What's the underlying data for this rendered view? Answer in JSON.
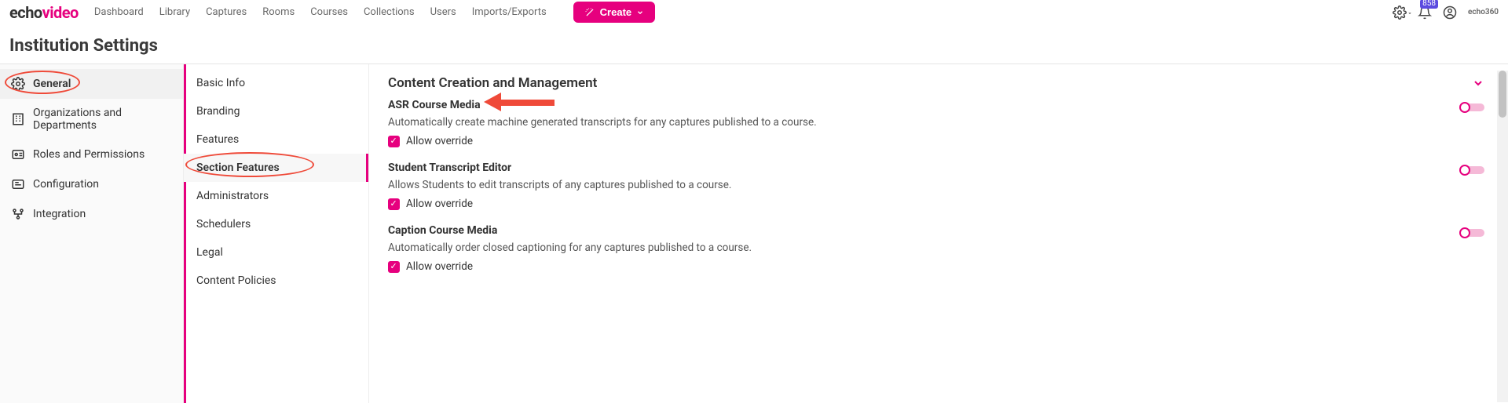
{
  "brand": {
    "part1": "echo",
    "part2": "video",
    "mini": "echo360"
  },
  "topnav": {
    "dashboard": "Dashboard",
    "library": "Library",
    "captures": "Captures",
    "rooms": "Rooms",
    "courses": "Courses",
    "collections": "Collections",
    "users": "Users",
    "imports": "Imports/Exports",
    "create": "Create"
  },
  "notifications": {
    "count": "858"
  },
  "page": {
    "title": "Institution Settings"
  },
  "sidebar1": {
    "general": "General",
    "orgs": "Organizations and Departments",
    "roles": "Roles and Permissions",
    "config": "Configuration",
    "integration": "Integration"
  },
  "sidebar2": {
    "basic": "Basic Info",
    "branding": "Branding",
    "features": "Features",
    "section_features": "Section Features",
    "admins": "Administrators",
    "schedulers": "Schedulers",
    "legal": "Legal",
    "content_policies": "Content Policies"
  },
  "content": {
    "section_title": "Content Creation and Management",
    "override_label": "Allow override",
    "asr": {
      "title": "ASR Course Media",
      "desc": "Automatically create machine generated transcripts for any captures published to a course."
    },
    "ste": {
      "title": "Student Transcript Editor",
      "desc": "Allows Students to edit transcripts of any captures published to a course."
    },
    "caption": {
      "title": "Caption Course Media",
      "desc": "Automatically order closed captioning for any captures published to a course."
    }
  }
}
